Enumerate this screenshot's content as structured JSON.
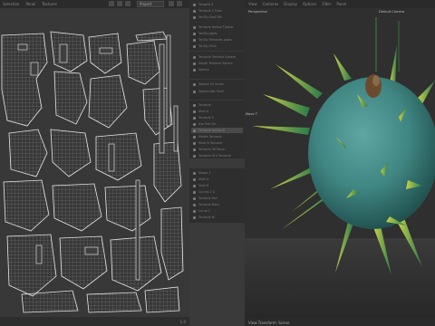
{
  "uv_editor": {
    "menu": [
      "Selection",
      "Panel",
      "Textures"
    ],
    "projection_select": "Project",
    "coordinate": "1.0"
  },
  "outliner": {
    "rows": [
      "Tangent A",
      "Tentacle 2 Floor",
      "TenTip Shell Mtl",
      "Tentacle Hollow Tipside",
      "TenTip pipes",
      "TenTip Tentacles pipes",
      "TenTip Shell",
      "Tentacle Tentacle Sphere",
      "Mouth Tentacle Sphere",
      "Sphere",
      "Sphere 45 Inside",
      "Sphere Abs Shell",
      "Tentacle",
      "Main A",
      "Tentacle S",
      "Eye Part 00",
      "Tentacle Hollow B",
      "Middle Tentacle",
      "Hook B Tentacle",
      "Tentacle 56 Tanon",
      "Tentacle S14 Tentacle",
      "Shape 1",
      "Shell A",
      "Shell B",
      "Curves 1 0",
      "Tentacle Part",
      "Tentacle Hard",
      "Curve 2",
      "Tentacle M",
      "Tentacle 35",
      "Pattern"
    ]
  },
  "viewport": {
    "menu": [
      "View",
      "Cameras",
      "Display",
      "Options",
      "Filter",
      "Panel"
    ],
    "view_label": "Perspective",
    "camera_label": "Default Camera",
    "move_label": "Move T",
    "footer": "View Transform: Scene"
  }
}
